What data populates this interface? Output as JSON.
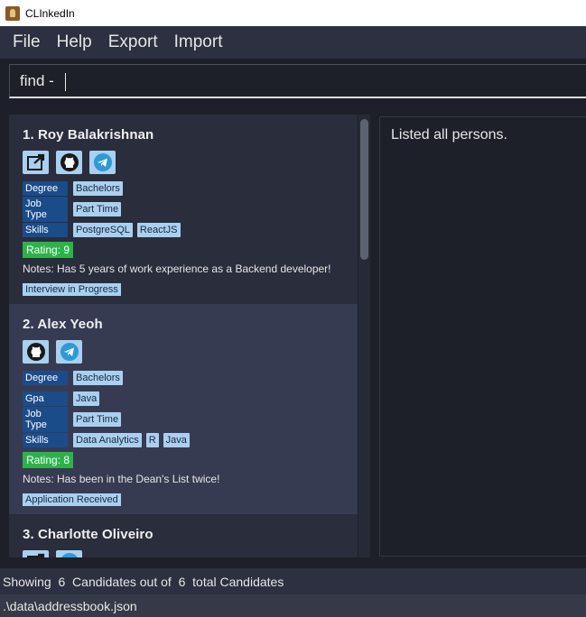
{
  "app": {
    "title": "CLInkedIn"
  },
  "menu": [
    "File",
    "Help",
    "Export",
    "Import"
  ],
  "command": {
    "value": "find -"
  },
  "result": {
    "message": "Listed all persons."
  },
  "candidates": [
    {
      "name": "1.  Roy Balakrishnan",
      "icons": [
        "external-link-icon",
        "github-icon",
        "telegram-icon"
      ],
      "fields": [
        {
          "label": "Degree",
          "values": [
            "Bachelors"
          ]
        },
        {
          "label": "Job Type",
          "values": [
            "Part Time"
          ]
        },
        {
          "label": "Skills",
          "values": [
            "PostgreSQL",
            "ReactJS"
          ]
        }
      ],
      "rating": "Rating: 9",
      "notes": "Notes: Has 5 years of work experience as a Backend developer!",
      "status": "Interview in Progress"
    },
    {
      "name": "2.  Alex Yeoh",
      "icons": [
        "github-icon",
        "telegram-icon"
      ],
      "fields": [
        {
          "label": "Degree",
          "values": [
            "Bachelors"
          ]
        },
        {
          "label": "Gpa",
          "values": [
            "Java"
          ]
        },
        {
          "label": "Job Type",
          "values": [
            "Part Time"
          ]
        },
        {
          "label": "Skills",
          "values": [
            "Data Analytics",
            "R",
            "Java"
          ]
        }
      ],
      "rating": "Rating: 8",
      "notes": "Notes: Has been in the Dean's List twice!",
      "status": "Application Received"
    },
    {
      "name": "3.  Charlotte Oliveiro",
      "icons": [
        "external-link-icon",
        "twitter-icon"
      ]
    }
  ],
  "status_bar": {
    "text": "Showing  6  Candidates out of  6  total Candidates"
  },
  "path_bar": {
    "text": ".\\data\\addressbook.json"
  },
  "colors": {
    "accent": "#a9d0ef",
    "label": "#1b4c8a",
    "rating": "#2bb34a",
    "background": "#1d2028"
  }
}
